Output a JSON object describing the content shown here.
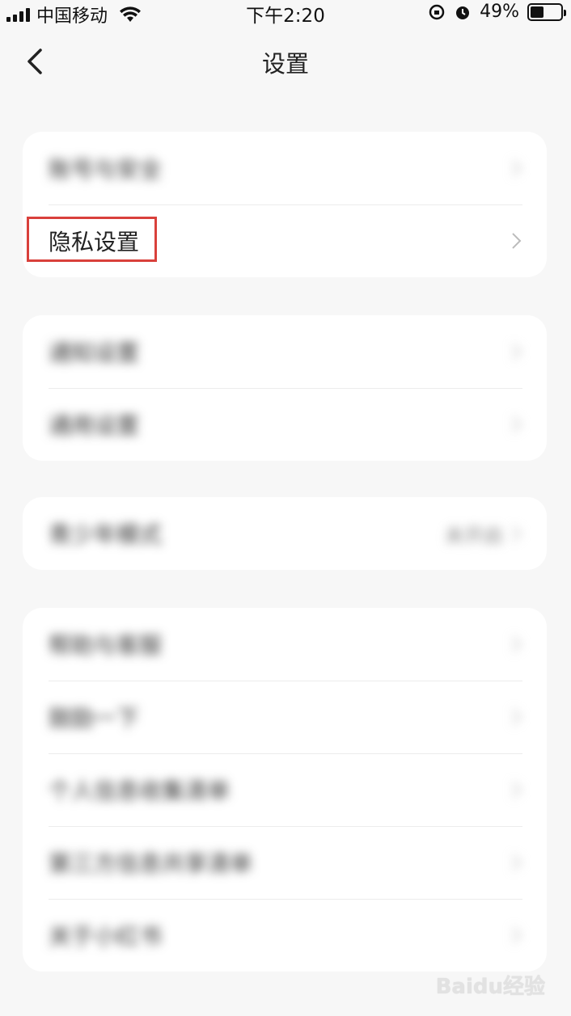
{
  "status_bar": {
    "carrier": "中国移动",
    "time": "下午2:20",
    "battery_percent": "49%",
    "battery_level": 0.49
  },
  "nav": {
    "title": "设置"
  },
  "groups": [
    {
      "rows": [
        {
          "label": "账号与安全",
          "blurred": true
        },
        {
          "label": "隐私设置",
          "blurred": false,
          "highlighted": true
        }
      ]
    },
    {
      "rows": [
        {
          "label": "通知设置",
          "blurred": true
        },
        {
          "label": "通用设置",
          "blurred": true
        }
      ]
    },
    {
      "rows": [
        {
          "label": "青少年模式",
          "blurred": true,
          "value": "未开启"
        }
      ]
    },
    {
      "rows": [
        {
          "label": "帮助与客服",
          "blurred": true
        },
        {
          "label": "鼓励一下",
          "blurred": true
        },
        {
          "label": "个人信息收集清单",
          "blurred": true
        },
        {
          "label": "第三方信息共享清单",
          "blurred": true
        },
        {
          "label": "关于小红书",
          "blurred": true
        }
      ]
    }
  ],
  "watermark": "Baidu经验",
  "colors": {
    "background": "#f7f7f7",
    "card": "#ffffff",
    "highlight": "#d9403b"
  }
}
